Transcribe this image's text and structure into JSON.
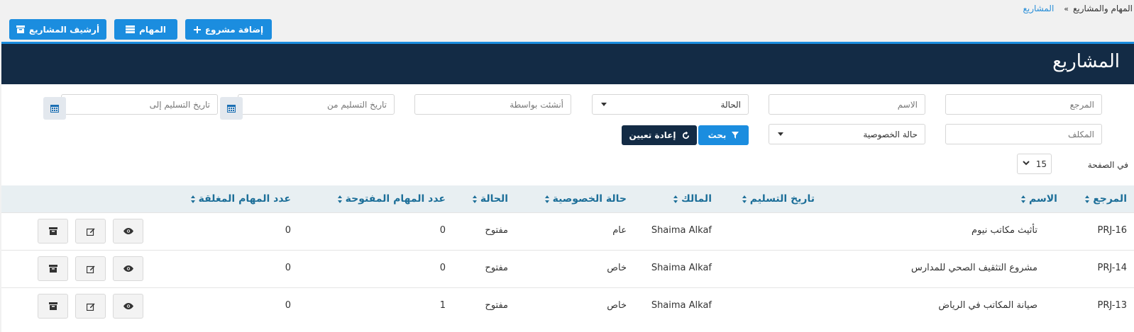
{
  "breadcrumb": {
    "root": "المهام والمشاريع",
    "separator": "»",
    "current": "المشاريع"
  },
  "toolbar": {
    "add_project": "إضافة مشروع",
    "tasks": "المهام",
    "archive": "أرشيف المشاريع"
  },
  "panel": {
    "title": "المشاريع"
  },
  "filters": {
    "reference_placeholder": "المرجع",
    "name_placeholder": "الاسم",
    "status_value": "الحالة",
    "created_by_placeholder": "أنشئت بواسطة",
    "delivery_from_placeholder": "تاريخ التسليم من",
    "delivery_to_placeholder": "تاريخ التسليم إلى",
    "assignee_placeholder": "المكلف",
    "privacy_value": "حالة الخصوصية",
    "search_label": "بحث",
    "reset_label": "إعادة تعيين"
  },
  "pagination": {
    "per_page_label": "في الصفحة",
    "per_page_value": "15"
  },
  "table": {
    "columns": [
      "المرجع",
      "الاسم",
      "تاريخ التسليم",
      "المالك",
      "حالة الخصوصية",
      "الحالة",
      "عدد المهام المفتوحة",
      "عدد المهام المغلقة"
    ],
    "rows": [
      {
        "ref": "PRJ-16",
        "name": "تأثيث مكاتب نيوم",
        "delivery": "",
        "owner": "Shaima Alkaf",
        "privacy": "عام",
        "status": "مفتوح",
        "open_tasks": "0",
        "closed_tasks": "0"
      },
      {
        "ref": "PRJ-14",
        "name": "مشروع التثقيف الصحي للمدارس",
        "delivery": "",
        "owner": "Shaima Alkaf",
        "privacy": "خاص",
        "status": "مفتوح",
        "open_tasks": "0",
        "closed_tasks": "0"
      },
      {
        "ref": "PRJ-13",
        "name": "صيانة المكاتب في الرياض",
        "delivery": "",
        "owner": "Shaima Alkaf",
        "privacy": "خاص",
        "status": "مفتوح",
        "open_tasks": "1",
        "closed_tasks": "0"
      }
    ]
  },
  "icons": {
    "view": "eye-icon",
    "edit": "edit-icon",
    "archive": "archive-box-icon",
    "calendar": "calendar-icon",
    "filter": "filter-icon",
    "reset": "refresh-icon",
    "plus": "plus-icon",
    "tasks": "server-list-icon"
  },
  "colors": {
    "primary": "#1b8ddf",
    "navy": "#132b45",
    "header_text": "#1d6f99"
  }
}
